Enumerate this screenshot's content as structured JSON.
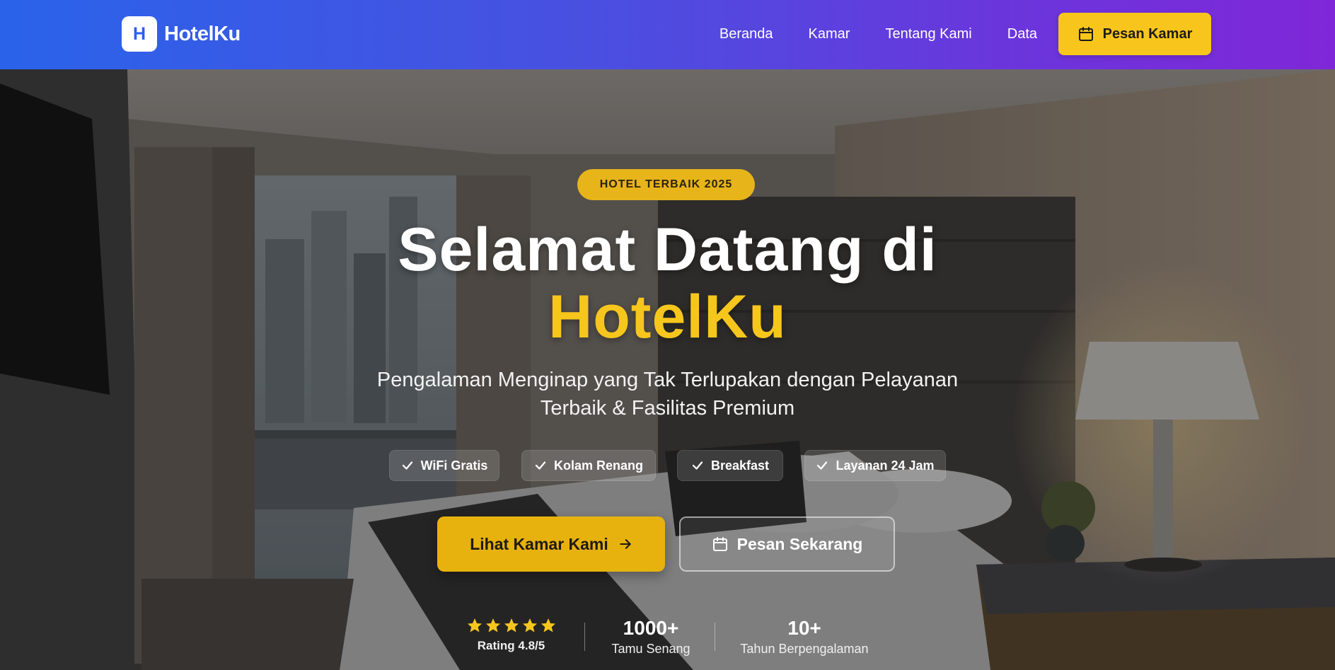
{
  "nav": {
    "logo_letter": "H",
    "brand": "HotelKu",
    "links": [
      "Beranda",
      "Kamar",
      "Tentang Kami",
      "Data"
    ],
    "cta": "Pesan Kamar"
  },
  "hero": {
    "badge": "HOTEL TERBAIK 2025",
    "title_line1": "Selamat Datang di",
    "title_line2": "HotelKu",
    "subtitle_line1": "Pengalaman Menginap yang Tak Terlupakan dengan Pelayanan",
    "subtitle_line2": "Terbaik & Fasilitas Premium",
    "features": [
      "WiFi Gratis",
      "Kolam Renang",
      "Breakfast",
      "Layanan 24 Jam"
    ],
    "primary_button": "Lihat Kamar Kami",
    "secondary_button": "Pesan Sekarang"
  },
  "stats": {
    "rating_label": "Rating 4.8/5",
    "rating_stars": 5,
    "guests_value": "1000+",
    "guests_label": "Tamu Senang",
    "years_value": "10+",
    "years_label": "Tahun Berpengalaman"
  },
  "colors": {
    "nav_gradient_start": "#2a63ea",
    "nav_gradient_end": "#7f27d8",
    "accent_yellow": "#f8c51c",
    "white": "#ffffff"
  },
  "icons": {
    "nav_cta": "calendar-icon",
    "feature_check": "check-icon",
    "primary_button": "arrow-right-icon",
    "secondary_button": "calendar-icon",
    "rating": "star-icon"
  }
}
